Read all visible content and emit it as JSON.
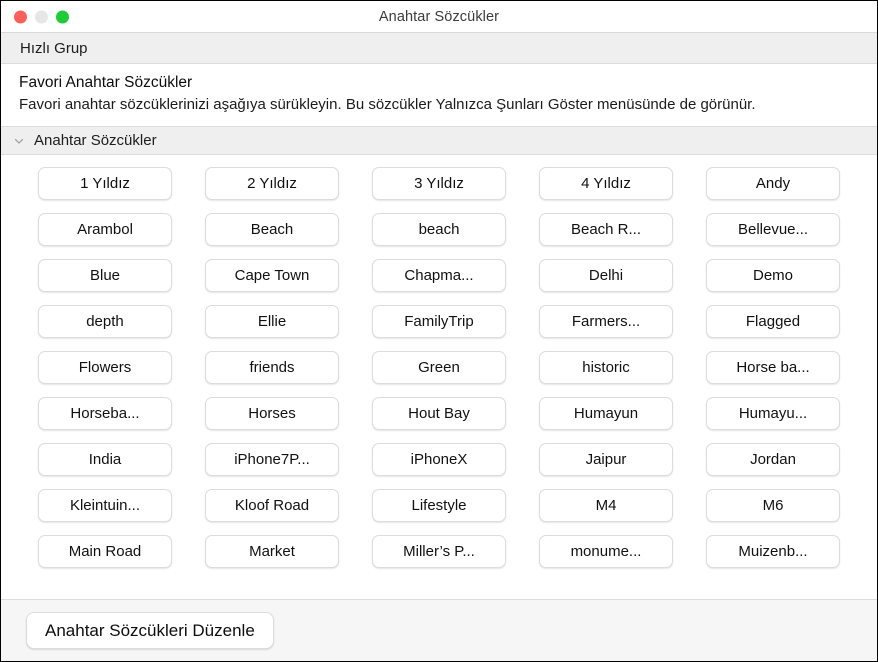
{
  "window": {
    "title": "Anahtar Sözcükler",
    "traffic_lights": [
      {
        "name": "close",
        "color": "#fc6058"
      },
      {
        "name": "minimize",
        "color": "#e6e6e6"
      },
      {
        "name": "zoom",
        "color": "#1ecc36"
      }
    ]
  },
  "quick_group": {
    "label": "Hızlı Grup"
  },
  "favorites": {
    "title": "Favori Anahtar Sözcükler",
    "description": "Favori anahtar sözcüklerinizi aşağıya sürükleyin. Bu sözcükler Yalnızca Şunları Göster menüsünde de görünür."
  },
  "keywords_section": {
    "title": "Anahtar Sözcükler",
    "disclosure_icon": "chevron-down-icon",
    "expanded": true,
    "columns": 5,
    "items": [
      "1 Yıldız",
      "2 Yıldız",
      "3 Yıldız",
      "4 Yıldız",
      "Andy",
      "Arambol",
      "Beach",
      "beach",
      "Beach R...",
      "Bellevue...",
      "Blue",
      "Cape Town",
      "Chapma...",
      "Delhi",
      "Demo",
      "depth",
      "Ellie",
      "FamilyTrip",
      "Farmers...",
      "Flagged",
      "Flowers",
      "friends",
      "Green",
      "historic",
      "Horse ba...",
      "Horseba...",
      "Horses",
      "Hout Bay",
      "Humayun",
      "Humayu...",
      "India",
      "iPhone7P...",
      "iPhoneX",
      "Jaipur",
      "Jordan",
      "Kleintuin...",
      "Kloof Road",
      "Lifestyle",
      "M4",
      "M6",
      "Main Road",
      "Market",
      "Miller’s P...",
      "monume...",
      "Muizenb..."
    ]
  },
  "footer": {
    "edit_button_label": "Anahtar Sözcükleri Düzenle"
  },
  "colors": {
    "window_background": "#ffffff",
    "bar_background": "#efefef",
    "footer_background": "#f6f6f6",
    "divider": "#dcdcdc",
    "button_border": "#dcdcdc",
    "text_primary": "#111111"
  }
}
